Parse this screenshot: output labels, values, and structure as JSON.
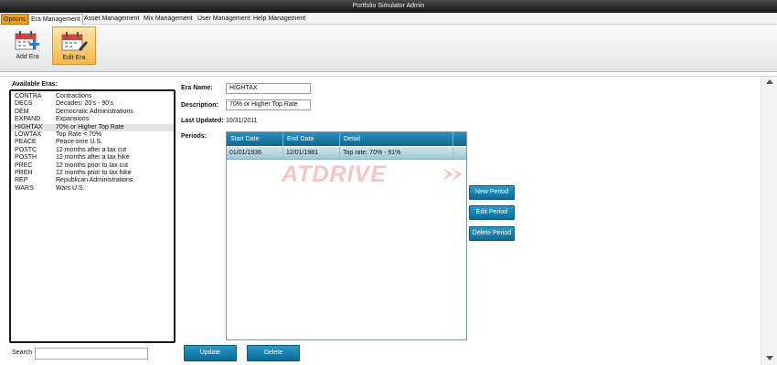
{
  "window": {
    "title": "Portfolio Simulator Admin"
  },
  "menu": {
    "tabs": [
      {
        "label": "Options"
      },
      {
        "label": "Era Management"
      },
      {
        "label": "Asset Management"
      },
      {
        "label": "Mix Management"
      },
      {
        "label": "User Management"
      },
      {
        "label": "Help Management"
      }
    ]
  },
  "ribbon": {
    "buttons": [
      {
        "label": "Add Era",
        "icon": "calendar-add-icon"
      },
      {
        "label": "Edit Era",
        "icon": "calendar-edit-icon"
      }
    ]
  },
  "eras": {
    "label": "Available Eras:",
    "selected_code": "HIGHTAX",
    "items": [
      {
        "code": "CONTRA",
        "description": "Contractions"
      },
      {
        "code": "DECS",
        "description": "Decades: 20's - 90's"
      },
      {
        "code": "DEM",
        "description": "Democratic Administrations"
      },
      {
        "code": "EXPAND",
        "description": "Expansions"
      },
      {
        "code": "HIGHTAX",
        "description": "70% or Higher Top Rate"
      },
      {
        "code": "LOWTAX",
        "description": "Top Rate < 70%"
      },
      {
        "code": "PEACE",
        "description": "Peace-time U.S."
      },
      {
        "code": "POSTC",
        "description": "12 months after a tax cut"
      },
      {
        "code": "POSTH",
        "description": "12 months after a tax hike"
      },
      {
        "code": "PREC",
        "description": "12 months prior to tax cut"
      },
      {
        "code": "PREH",
        "description": "12 months prior to tax hike"
      },
      {
        "code": "REP",
        "description": "Republican Administrations"
      },
      {
        "code": "WARS",
        "description": "Wars U.S."
      }
    ]
  },
  "search": {
    "label": "Search",
    "value": ""
  },
  "form": {
    "era_name_label": "Era Name:",
    "era_name_value": "HIGHTAX",
    "description_label": "Description:",
    "description_value": "70% or Higher Top Rate",
    "last_updated_label": "Last Updated:",
    "last_updated_value": "10/31/2011",
    "periods_label": "Periods:"
  },
  "periods": {
    "columns": [
      "Start Date",
      "End Data",
      "Detail"
    ],
    "rows": [
      {
        "start": "01/01/1936",
        "end": "12/01/1981",
        "detail": "Top rate: 70% - 91%"
      }
    ]
  },
  "watermark": {
    "text": "ATDRIVE"
  },
  "period_buttons": {
    "new": "New Period",
    "edit": "Edit Period",
    "delete": "Delete Period"
  },
  "actions": {
    "update": "Update",
    "delete": "Delete"
  },
  "colors": {
    "accent_blue": "#0d6791",
    "options_tab": "#f0a020",
    "ribbon_selected": "#f6b749",
    "titlebar": "#141414"
  }
}
